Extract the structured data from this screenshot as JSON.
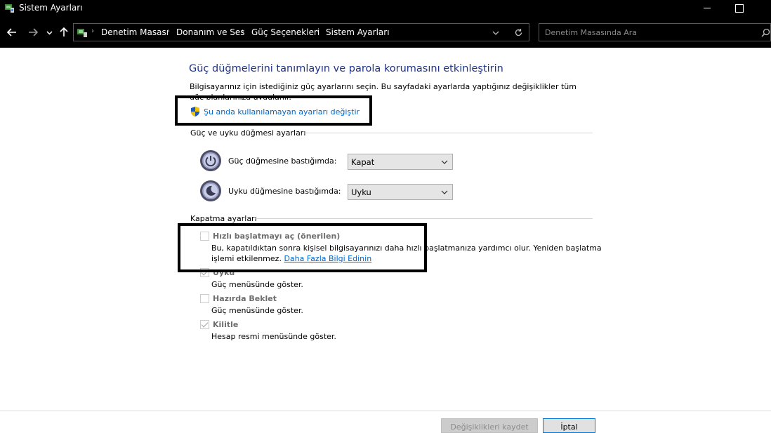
{
  "window": {
    "title": "Sistem Ayarları"
  },
  "navigation": {
    "breadcrumbs": [
      "Denetim Masası",
      "Donanım ve Ses",
      "Güç Seçenekleri",
      "Sistem Ayarları"
    ],
    "search_placeholder": "Denetim Masasında Ara"
  },
  "main": {
    "heading": "Güç düğmelerini tanımlayın ve parola korumasını etkinleştirin",
    "description": "Bilgisayarınız için istediğiniz güç ayarlarını seçin. Bu sayfadaki ayarlarda yaptığınız değişiklikler tüm güç planlarınıza uygulanır.",
    "change_link": "Şu anda kullanılamayan ayarları değiştir",
    "power_section_title": "Güç ve uyku düğmesi ayarları",
    "power_button_label": "Güç düğmesine bastığımda:",
    "power_button_value": "Kapat",
    "sleep_button_label": "Uyku düğmesine bastığımda:",
    "sleep_button_value": "Uyku",
    "shutdown_section_title": "Kapatma ayarları",
    "fast_startup": {
      "label": "Hızlı başlatmayı aç (önerilen)",
      "desc_line1": "Bu, kapatıldıktan sonra kişisel bilgisayarınızı daha hızlı başlatmanıza yardımcı olur. Yeniden başlatma",
      "desc_line2": "işlemi etkilenmez.",
      "more_info": "Daha Fazla Bilgi Edinin",
      "checked": false
    },
    "sleep_option": {
      "label": "Uyku",
      "desc": "Güç menüsünde göster.",
      "checked": true
    },
    "hibernate_option": {
      "label": "Hazırda Beklet",
      "desc": "Güç menüsünde göster.",
      "checked": false
    },
    "lock_option": {
      "label": "Kilitle",
      "desc": "Hesap resmi menüsünde göster.",
      "checked": true
    }
  },
  "footer": {
    "save_label": "Değişiklikleri kaydet",
    "cancel_label": "İptal"
  },
  "colors": {
    "heading": "#1e3287",
    "link": "#0066cc",
    "titlebar": "#000000"
  }
}
